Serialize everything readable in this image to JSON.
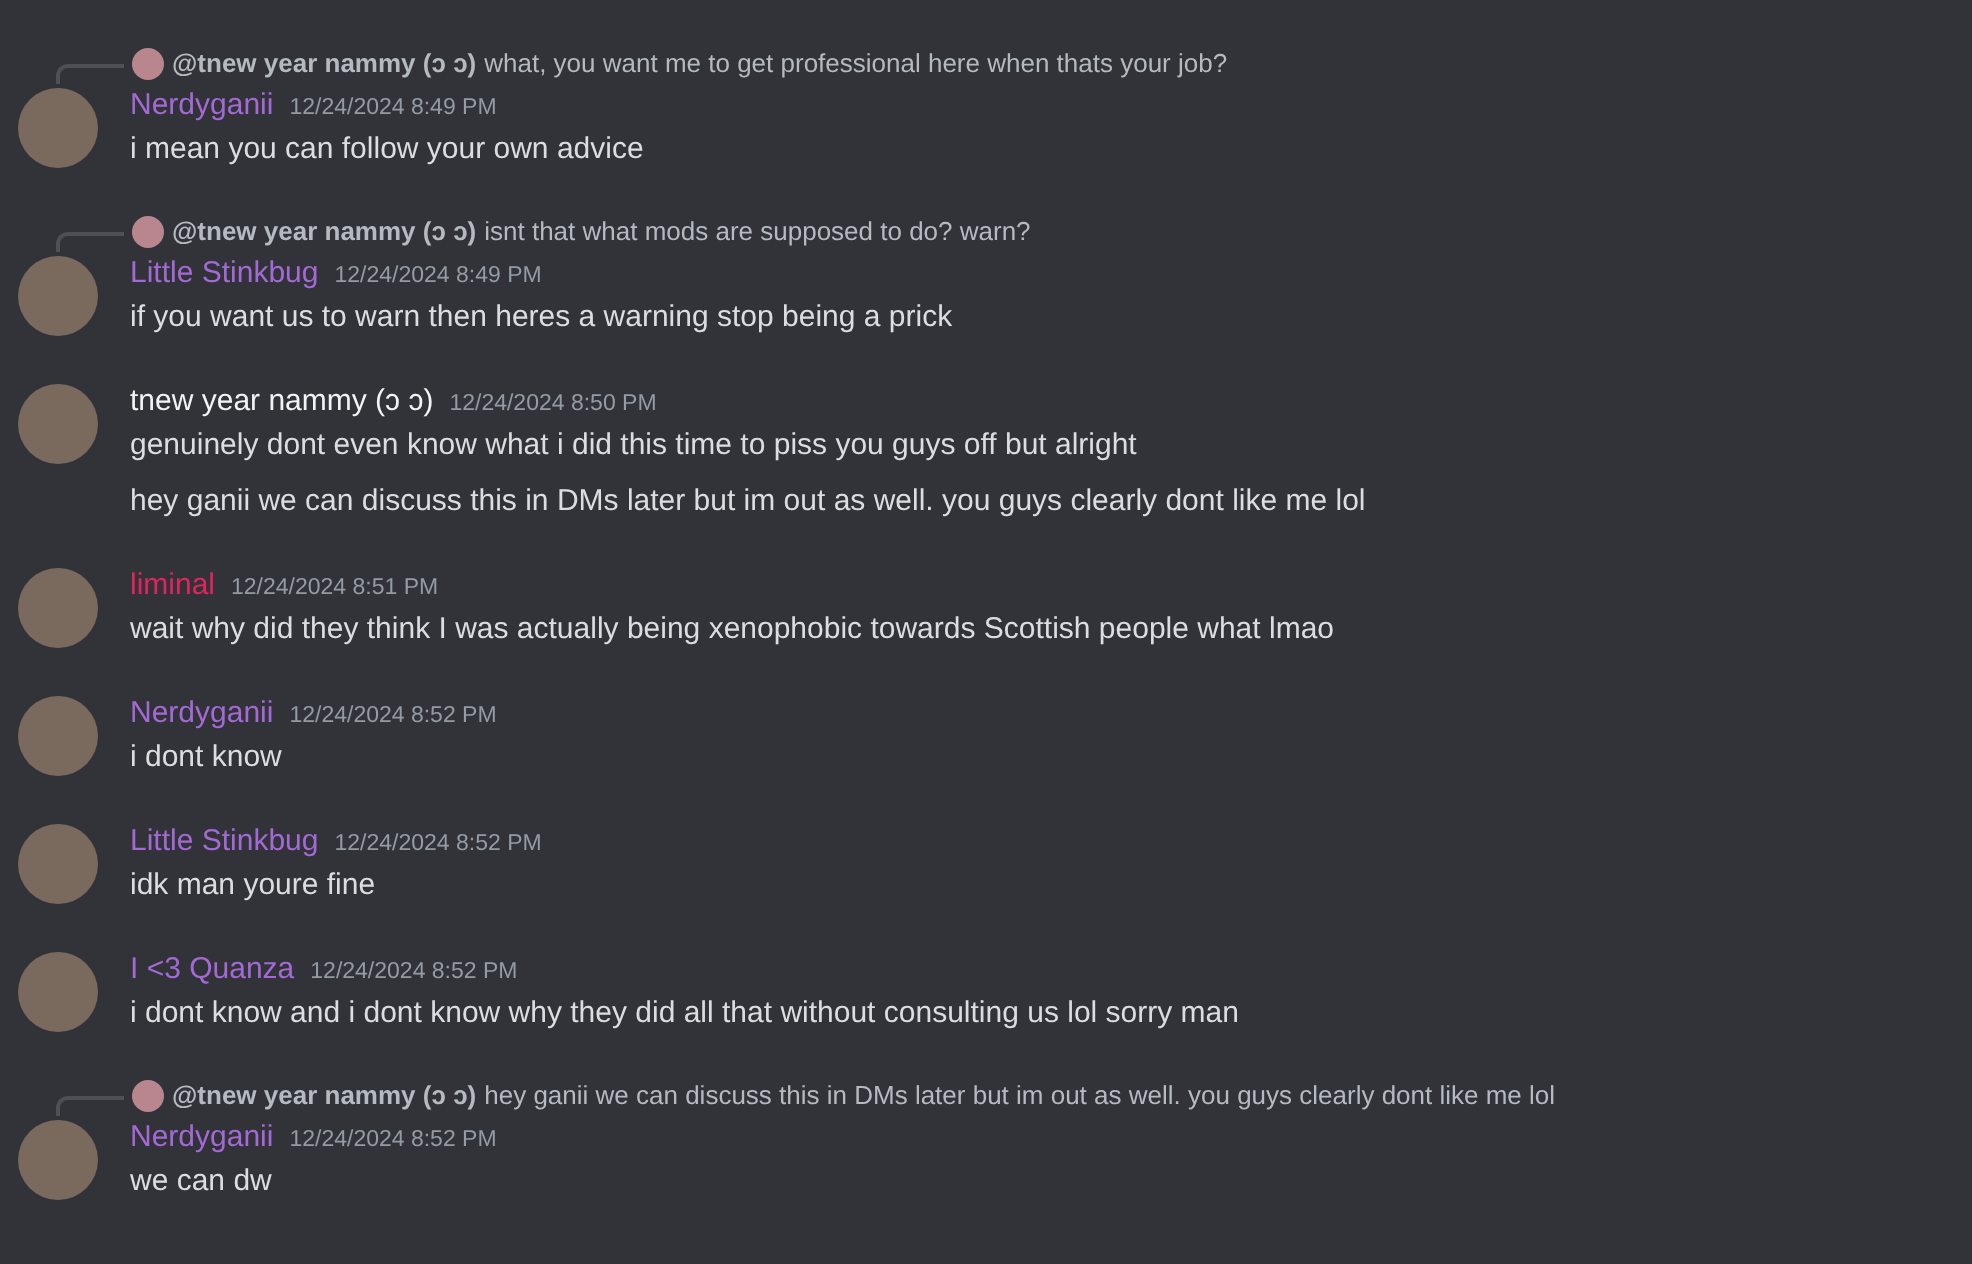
{
  "messages": [
    {
      "reply": {
        "author": "@tnew year nammy (ↄ ↄ)",
        "text": "what, you want me to get professional here when thats your job?"
      },
      "author": "Nerdyganii",
      "color": "#a369d4",
      "time": "12/24/2024 8:49 PM",
      "lines": [
        "i mean you can follow your own advice"
      ]
    },
    {
      "reply": {
        "author": "@tnew year nammy (ↄ ↄ)",
        "text": "isnt that what mods are supposed to do? warn?"
      },
      "author": "Little Stinkbug",
      "color": "#a369d4",
      "time": "12/24/2024 8:49 PM",
      "lines": [
        "if you want us to warn then heres a warning stop being a prick"
      ]
    },
    {
      "author": "tnew year nammy (ↄ ↄ)",
      "color": "#f2f3f5",
      "time": "12/24/2024 8:50 PM",
      "lines": [
        "genuinely dont even know what i did this time to piss you guys off but alright",
        "hey ganii we can discuss this in DMs later but im out as well. you guys clearly dont like me lol"
      ]
    },
    {
      "author": "liminal",
      "color": "#e0245e",
      "time": "12/24/2024 8:51 PM",
      "lines": [
        "wait why did they think I was actually being xenophobic towards Scottish people what lmao"
      ]
    },
    {
      "author": "Nerdyganii",
      "color": "#a369d4",
      "time": "12/24/2024 8:52 PM",
      "lines": [
        "i dont know"
      ]
    },
    {
      "author": "Little Stinkbug",
      "color": "#a369d4",
      "time": "12/24/2024 8:52 PM",
      "lines": [
        "idk man youre fine"
      ]
    },
    {
      "author": "I <3 Quanza",
      "color": "#a369d4",
      "time": "12/24/2024 8:52 PM",
      "lines": [
        "i dont know and i dont know why they did all that without consulting us lol sorry man"
      ]
    },
    {
      "reply": {
        "author": "@tnew year nammy (ↄ ↄ)",
        "text": "hey ganii we can discuss this in DMs later but im out as well. you guys clearly dont like me lol"
      },
      "author": "Nerdyganii",
      "color": "#a369d4",
      "time": "12/24/2024 8:52 PM",
      "lines": [
        "we can dw"
      ]
    }
  ]
}
